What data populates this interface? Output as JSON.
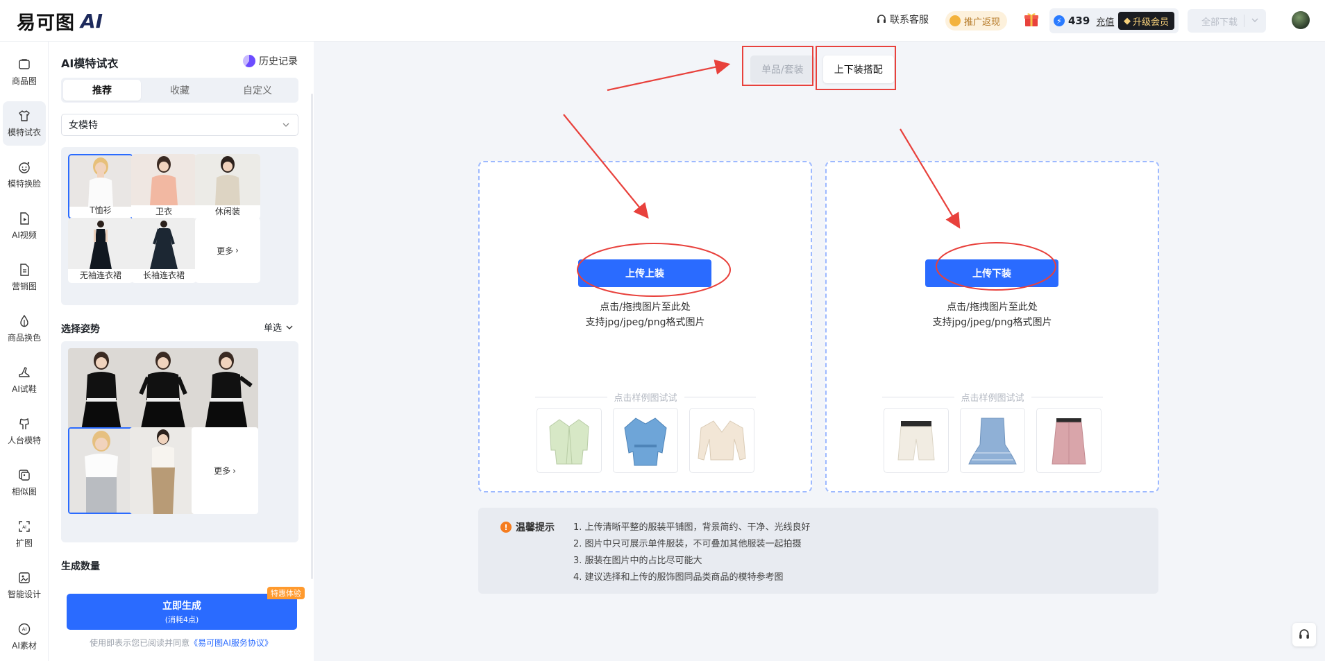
{
  "brand": {
    "logo_text": "易可图",
    "logo_ai": "AI"
  },
  "header": {
    "service": "联系客服",
    "promo": "推广返现",
    "points": "439",
    "recharge": "充值",
    "vip": "升级会员",
    "download_all": "全部下载"
  },
  "nav": {
    "items": [
      {
        "label": "商品图",
        "icon": "image-icon"
      },
      {
        "label": "模特试衣",
        "icon": "shirt-icon"
      },
      {
        "label": "模特换脸",
        "icon": "face-icon"
      },
      {
        "label": "AI视频",
        "icon": "video-icon"
      },
      {
        "label": "营销图",
        "icon": "document-icon"
      },
      {
        "label": "商品换色",
        "icon": "color-drop-icon"
      },
      {
        "label": "AI试鞋",
        "icon": "shoe-icon"
      },
      {
        "label": "人台模特",
        "icon": "mannequin-icon"
      },
      {
        "label": "相似图",
        "icon": "similar-image-icon"
      },
      {
        "label": "扩图",
        "icon": "expand-image-icon"
      },
      {
        "label": "智能设计",
        "icon": "design-icon"
      },
      {
        "label": "AI素材",
        "icon": "ai-material-icon"
      }
    ],
    "active": "模特试衣"
  },
  "panel": {
    "title": "AI模特试衣",
    "history": "历史记录",
    "tabs": [
      "推荐",
      "收藏",
      "自定义"
    ],
    "model_select": "女模特",
    "clothing": [
      {
        "label": "T恤衫"
      },
      {
        "label": "卫衣"
      },
      {
        "label": "休闲装"
      },
      {
        "label": "无袖连衣裙"
      },
      {
        "label": "长袖连衣裙"
      }
    ],
    "more": "更多",
    "pose_title": "选择姿势",
    "pose_mode": "单选",
    "count_title": "生成数量",
    "generate": "立即生成",
    "generate_cost": "(消耗4点)",
    "generate_badge": "特惠体验",
    "agreement_prefix": "使用即表示您已阅读并同意",
    "agreement_link": "《易可图AI服务协议》"
  },
  "main": {
    "modes": [
      "单品/套装",
      "上下装搭配"
    ],
    "active_mode": "上下装搭配",
    "top_upload": {
      "button": "上传上装",
      "hint1": "点击/拖拽图片至此处",
      "hint2": "支持jpg/jpeg/png格式图片",
      "samples_label": "点击样例图试试"
    },
    "bottom_upload": {
      "button": "上传下装",
      "hint1": "点击/拖拽图片至此处",
      "hint2": "支持jpg/jpeg/png格式图片",
      "samples_label": "点击样例图试试"
    },
    "tips_title": "温馨提示",
    "tips": [
      "1. 上传清晰平整的服装平铺图，背景简约、干净、光线良好",
      "2. 图片中只可展示单件服装，不可叠加其他服装一起拍摄",
      "3. 服装在图片中的占比尽可能大",
      "4. 建议选择和上传的服饰图同品类商品的模特参考图"
    ]
  },
  "colors": {
    "accent": "#2a6bff",
    "annotation": "#e8413c",
    "vip_gold": "#f5cf7a"
  }
}
